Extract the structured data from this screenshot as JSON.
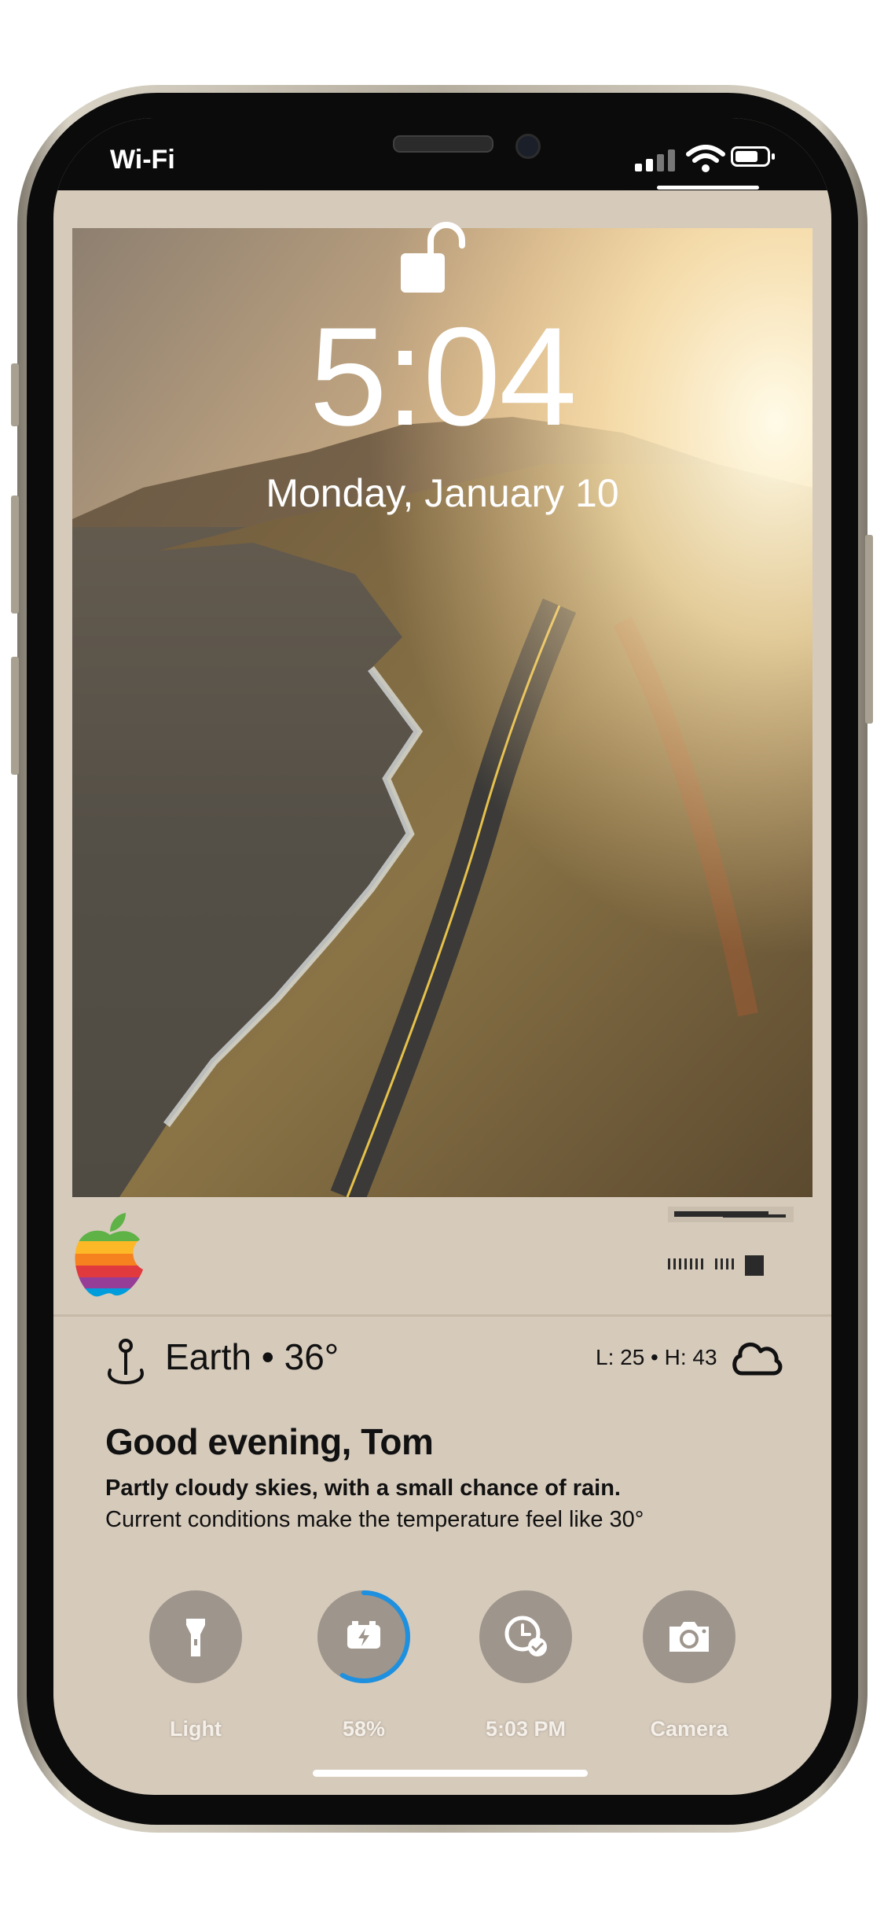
{
  "status_bar": {
    "carrier": "Wi-Fi"
  },
  "lock_screen": {
    "time": "5:04",
    "date": "Monday, January 10"
  },
  "weather": {
    "location_line": "Earth • 36°",
    "low_high": "L: 25 • H: 43",
    "greeting": "Good evening, Tom",
    "forecast": "Partly cloudy skies, with a small chance of rain.",
    "conditions": "Current conditions make the temperature feel like 30°"
  },
  "quick_actions": [
    {
      "label": "Light",
      "icon": "flashlight-icon"
    },
    {
      "label": "58%",
      "icon": "battery-charging-icon",
      "progress": 0.58
    },
    {
      "label": "5:03 PM",
      "icon": "clock-check-icon"
    },
    {
      "label": "Camera",
      "icon": "camera-icon"
    }
  ],
  "colors": {
    "screen_bg": "#d6cabb",
    "button_bg": "#9e958c",
    "battery_ring": "#1e90e0",
    "text": "#111111"
  }
}
